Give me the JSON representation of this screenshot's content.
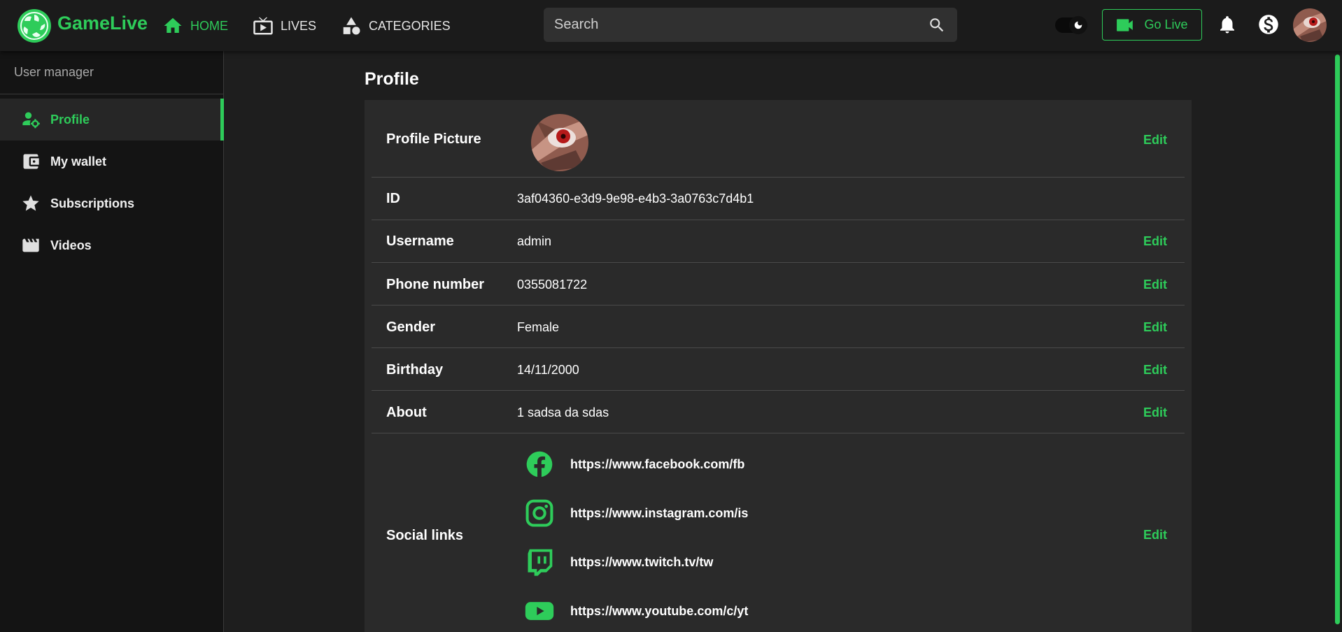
{
  "app": {
    "brand": "GameLive"
  },
  "colors": {
    "accent": "#2ecc5a",
    "background": "#1e1e1e",
    "card": "#2a2a2a",
    "sidebar": "#141414"
  },
  "nav": {
    "items": [
      {
        "label": "HOME",
        "icon": "home-icon",
        "active": true
      },
      {
        "label": "LIVES",
        "icon": "tv-icon",
        "active": false
      },
      {
        "label": "CATEGORIES",
        "icon": "shapes-icon",
        "active": false
      }
    ]
  },
  "search": {
    "placeholder": "Search",
    "value": ""
  },
  "header": {
    "go_live_label": "Go Live"
  },
  "sidebar": {
    "title": "User manager",
    "items": [
      {
        "label": "Profile",
        "icon": "user-gear-icon",
        "active": true
      },
      {
        "label": "My wallet",
        "icon": "wallet-icon",
        "active": false
      },
      {
        "label": "Subscriptions",
        "icon": "star-icon",
        "active": false
      },
      {
        "label": "Videos",
        "icon": "clapperboard-icon",
        "active": false
      }
    ]
  },
  "profile": {
    "title": "Profile",
    "edit_label": "Edit",
    "picture_label": "Profile Picture",
    "fields": [
      {
        "label": "ID",
        "value": "3af04360-e3d9-9e98-e4b3-3a0763c7d4b1",
        "editable": false
      },
      {
        "label": "Username",
        "value": "admin",
        "editable": true
      },
      {
        "label": "Phone number",
        "value": "0355081722",
        "editable": true
      },
      {
        "label": "Gender",
        "value": "Female",
        "editable": true
      },
      {
        "label": "Birthday",
        "value": "14/11/2000",
        "editable": true
      },
      {
        "label": "About",
        "value": "1 sadsa da sdas",
        "editable": true
      }
    ],
    "social_label": "Social links",
    "social_links": [
      {
        "icon": "facebook-icon",
        "url": "https://www.facebook.com/fb"
      },
      {
        "icon": "instagram-icon",
        "url": "https://www.instagram.com/is"
      },
      {
        "icon": "twitch-icon",
        "url": "https://www.twitch.tv/tw"
      },
      {
        "icon": "youtube-icon",
        "url": "https://www.youtube.com/c/yt"
      }
    ]
  }
}
